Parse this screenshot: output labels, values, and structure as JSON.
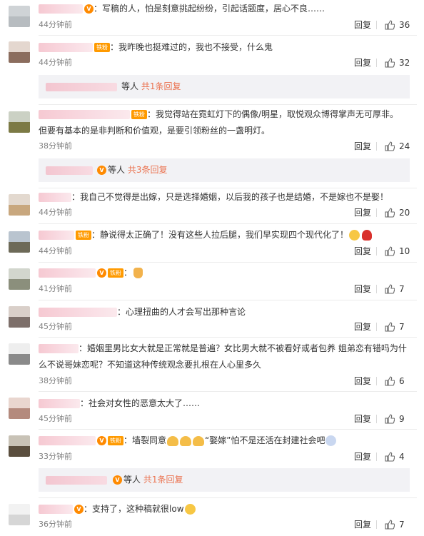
{
  "ui": {
    "reply_label": "回复",
    "waiting_text": "等人",
    "colon": "："
  },
  "comments": [
    {
      "text": "写稿的人，怕是刻意挑起纷纷，引起话题度，居心不良……",
      "time": "44分钟前",
      "likes": "36"
    },
    {
      "text": "我昨晚也挺难过的，我也不接受，什么鬼",
      "time": "44分钟前",
      "likes": "32",
      "fan_badge": "铁粉",
      "sub": {
        "summary": "共1条回复"
      }
    },
    {
      "text": "我觉得站在霓虹灯下的偶像/明星，取悦观众博得掌声无可厚非。",
      "text2": "但要有基本的是非判断和价值观，是要引领粉丝的一盏明灯。",
      "time": "38分钟前",
      "likes": "24",
      "fan_badge": "铁粉",
      "sub": {
        "summary": "共3条回复"
      }
    },
    {
      "text": "我自己不觉得是出嫁，只是选择婚姻，以后我的孩子也是结婚，不是嫁也不是娶！",
      "time": "44分钟前",
      "likes": "20"
    },
    {
      "text": "静说得太正确了！没有这些人拉后腿，我们早实现四个现代化了！",
      "time": "44分钟前",
      "likes": "10",
      "fan_badge": "铁粉"
    },
    {
      "text": "",
      "time": "41分钟前",
      "likes": "7",
      "fan_badge": "铁粉"
    },
    {
      "text": "心理扭曲的人才会写出那种言论",
      "time": "45分钟前",
      "likes": "7"
    },
    {
      "text": "婚姻里男比女大就是正常就是普遍？女比男大就不被看好或者包养 姐弟恋有错吗为什",
      "text2": "么不说哥妹恋呢？不知道这种传统观念要扎根在人心里多久",
      "time": "38分钟前",
      "likes": "6"
    },
    {
      "text": "社会对女性的恶意太大了……",
      "time": "45分钟前",
      "likes": "9"
    },
    {
      "text_a": "墙裂同意",
      "text_b": "“娶嫁”怕不是还活在封建社会吧",
      "time": "33分钟前",
      "likes": "4",
      "fan_badge": "铁粉",
      "sub": {
        "summary": "共1条回复"
      }
    },
    {
      "text": "支持了，这种稿就很low",
      "time": "36分钟前",
      "likes": "7"
    }
  ],
  "colors": {
    "link_orange": "#eb7350",
    "time_gray": "#808080",
    "sub_bg": "#f2f2f5",
    "badge_orange": "#ff9a00"
  },
  "icons": [
    "thumbs-up-icon",
    "vip-crown-icon",
    "smile-emoji",
    "thumbs-up-emoji",
    "rose-emoji",
    "clap-emoji",
    "shocked-emoji"
  ]
}
